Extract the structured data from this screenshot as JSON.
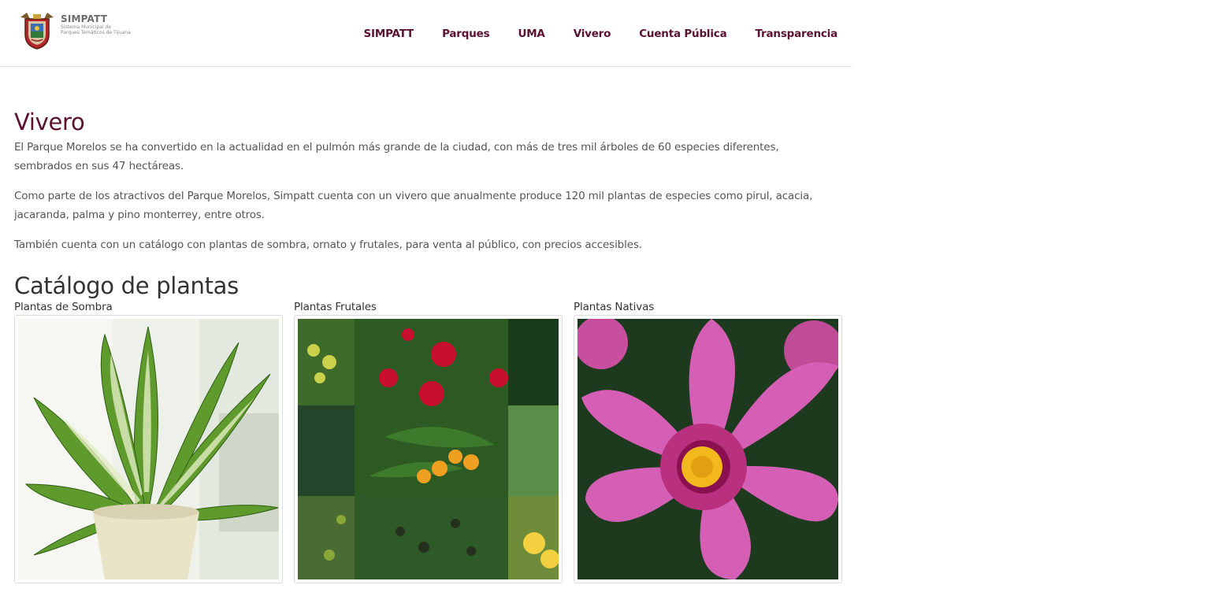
{
  "brand": {
    "name": "SIMPATT",
    "subtitle_line1": "Sistema Municipal de",
    "subtitle_line2": "Parques Temáticos de Tijuana"
  },
  "nav": {
    "items": [
      {
        "label": "SIMPATT"
      },
      {
        "label": "Parques"
      },
      {
        "label": "UMA"
      },
      {
        "label": "Vivero"
      },
      {
        "label": "Cuenta Pública"
      },
      {
        "label": "Transparencia"
      }
    ]
  },
  "page": {
    "title": "Vivero",
    "paragraphs": [
      "El Parque Morelos se ha convertido en la actualidad en el pulmón más grande de la ciudad, con más de tres mil árboles de 60 especies diferentes, sembrados en sus 47 hectáreas.",
      "Como parte de los atractivos del Parque Morelos, Simpatt cuenta con un vivero que anualmente produce 120 mil plantas de especies como pirul, acacia, jacaranda, palma y pino monterrey, entre otros.",
      "También cuenta con un catálogo con plantas de sombra, ornato y frutales, para venta al público, con precios accesibles."
    ]
  },
  "catalog": {
    "title": "Catálogo de plantas",
    "items": [
      {
        "label": "Plantas de Sombra"
      },
      {
        "label": "Plantas Frutales"
      },
      {
        "label": "Plantas Nativas"
      }
    ]
  },
  "colors": {
    "accent": "#5a1130",
    "text": "#555555",
    "heading": "#333333"
  }
}
